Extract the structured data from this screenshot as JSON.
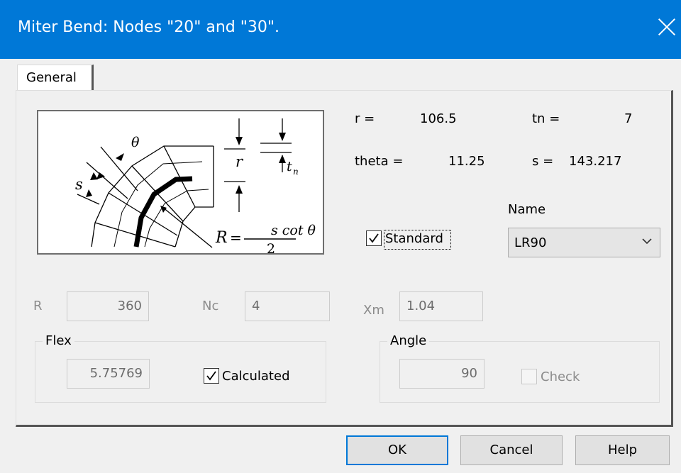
{
  "window": {
    "title": "Miter Bend: Nodes  \"20\" and \"30\"."
  },
  "tabs": [
    {
      "label": "General"
    }
  ],
  "diagram": {
    "labels": {
      "theta": "θ",
      "r": "r",
      "tn": "t",
      "tn_sub": "n",
      "s": "s",
      "R": "R",
      "eq": "=",
      "num": "s cot θ",
      "den": "2"
    }
  },
  "readouts": {
    "r_label": "r =",
    "r_value": "106.5",
    "tn_label": "tn =",
    "tn_value": "7",
    "theta_label": "theta =",
    "theta_value": "11.25",
    "s_label": "s =",
    "s_value": "143.217"
  },
  "name": {
    "label": "Name",
    "selected": "LR90"
  },
  "standard": {
    "label": "Standard",
    "checked": true
  },
  "fields": {
    "R_label": "R",
    "R_value": "360",
    "Nc_label": "Nc",
    "Nc_value": "4",
    "Xm_label": "Xm",
    "Xm_value": "1.04"
  },
  "flex": {
    "label": "Flex",
    "value": "5.75769",
    "calculated_label": "Calculated",
    "calculated_checked": true
  },
  "angle": {
    "label": "Angle",
    "value": "90",
    "check_label": "Check",
    "check_checked": false
  },
  "buttons": {
    "ok": "OK",
    "cancel": "Cancel",
    "help": "Help"
  }
}
